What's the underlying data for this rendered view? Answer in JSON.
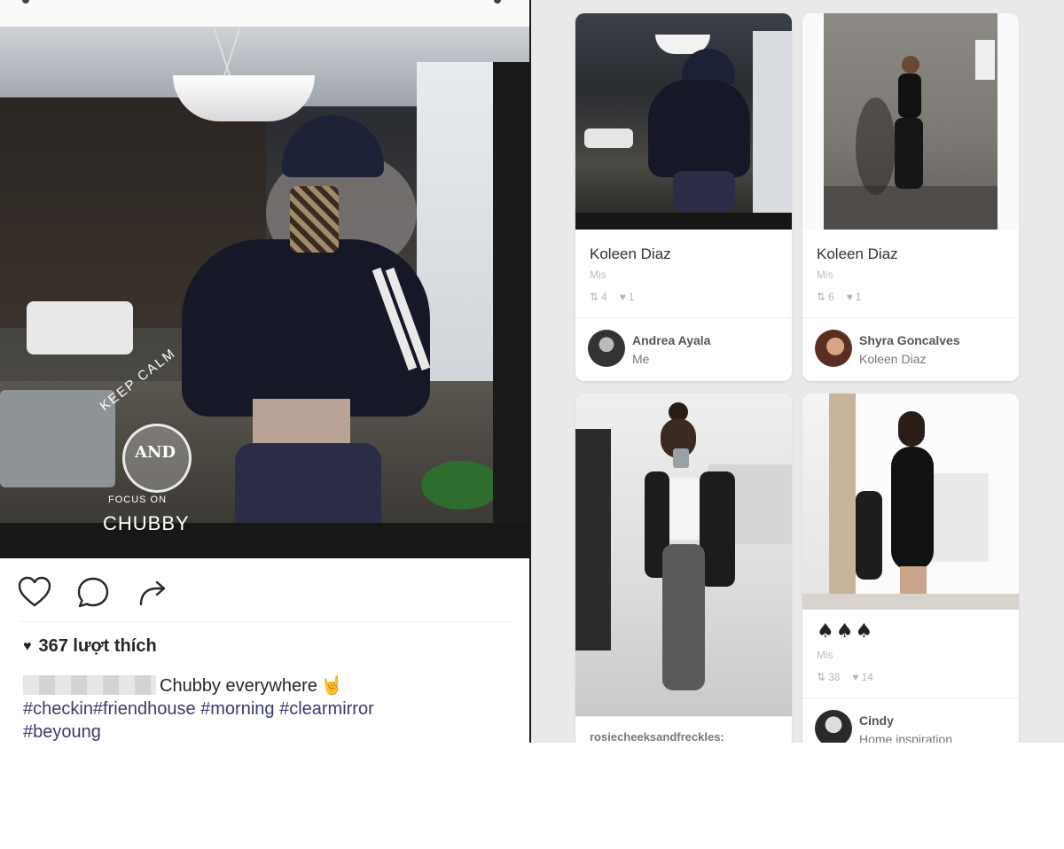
{
  "post": {
    "likes_label": "367 lượt thích",
    "caption_text": "Chubby everywhere",
    "caption_emoji": "🤘",
    "hashtags_line1": "#checkin#friendhouse #morning #clearmirror",
    "hashtags_line2": "#beyoung",
    "watermark": {
      "keep": "KEEP CALM",
      "and": "AND",
      "focus": "FOCUS ON",
      "chubby": "CHUBBY"
    },
    "icons": [
      "heart-icon",
      "comment-icon",
      "share-icon"
    ]
  },
  "pins": [
    {
      "title": "Koleen Diaz",
      "board": "Mis",
      "repins": "4",
      "likes": "1",
      "user": "Andrea Ayala",
      "user_board": "Me"
    },
    {
      "title": "Koleen Diaz",
      "board": "Mis",
      "repins": "6",
      "likes": "1",
      "user": "Shyra Goncalves",
      "user_board": "Koleen Diaz"
    },
    {
      "title": "rosiecheeksandfreckles:"
    },
    {
      "title": "♠♠♠",
      "board": "Mis",
      "repins": "38",
      "likes": "14",
      "user": "Cindy",
      "user_board": "Home inspiration"
    }
  ],
  "colors": {
    "hashtag": "#3b3b6e",
    "pinterest_bg": "#e9e9ea"
  }
}
